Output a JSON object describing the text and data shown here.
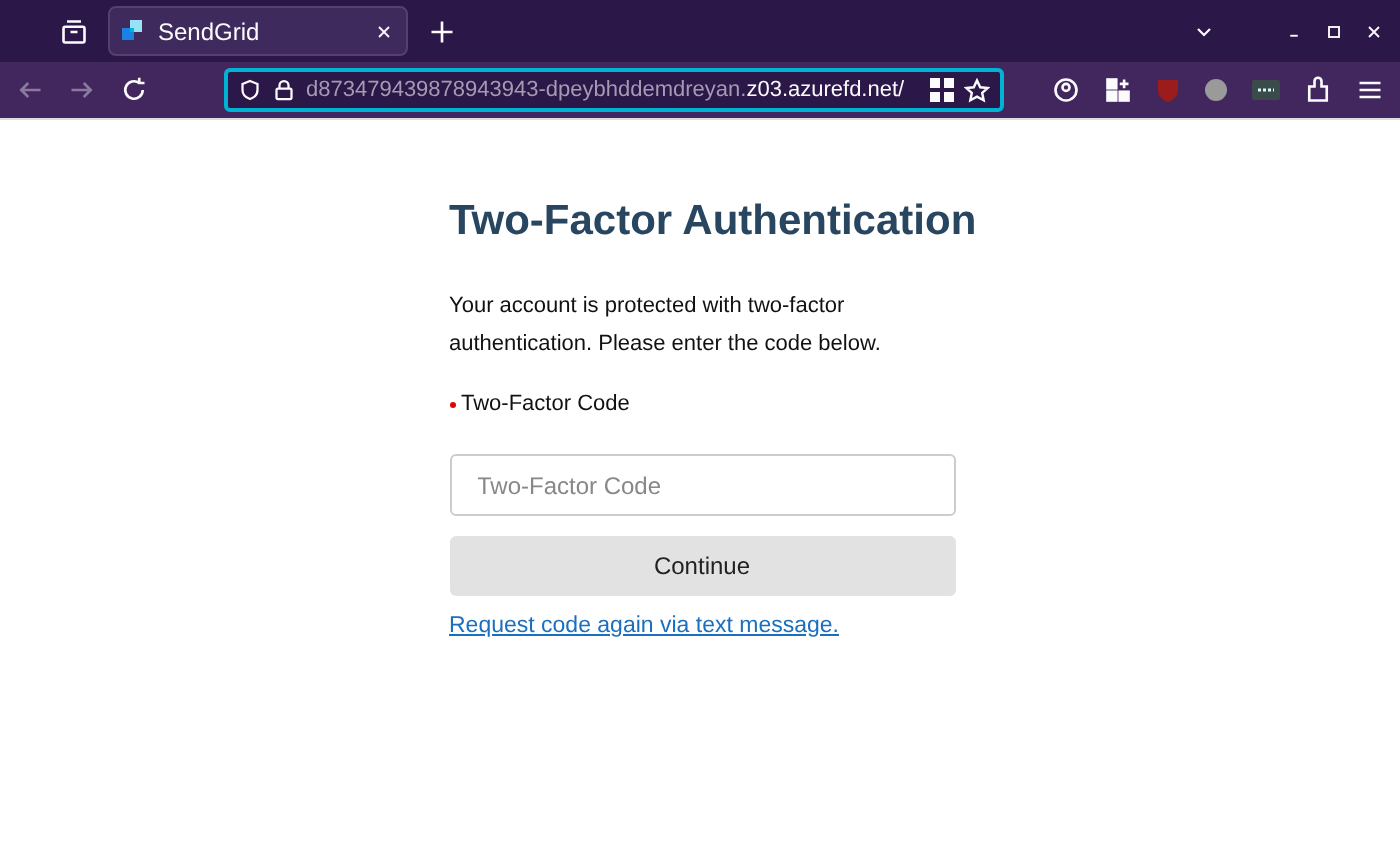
{
  "browser": {
    "tabs": [
      {
        "title": "SendGrid",
        "selected": true
      }
    ],
    "url": {
      "path": "d873479439878943943-dpeybhddemdreyan.",
      "domain": "z03.azurefd.net/"
    }
  },
  "page": {
    "title": "Two-Factor Authentication",
    "description": "Your account is protected with two-factor authentication. Please enter the code below.",
    "field": {
      "label": "Two-Factor Code",
      "required": true,
      "placeholder": "Two-Factor Code"
    },
    "button": "Continue",
    "link": "Request code again via text message."
  }
}
